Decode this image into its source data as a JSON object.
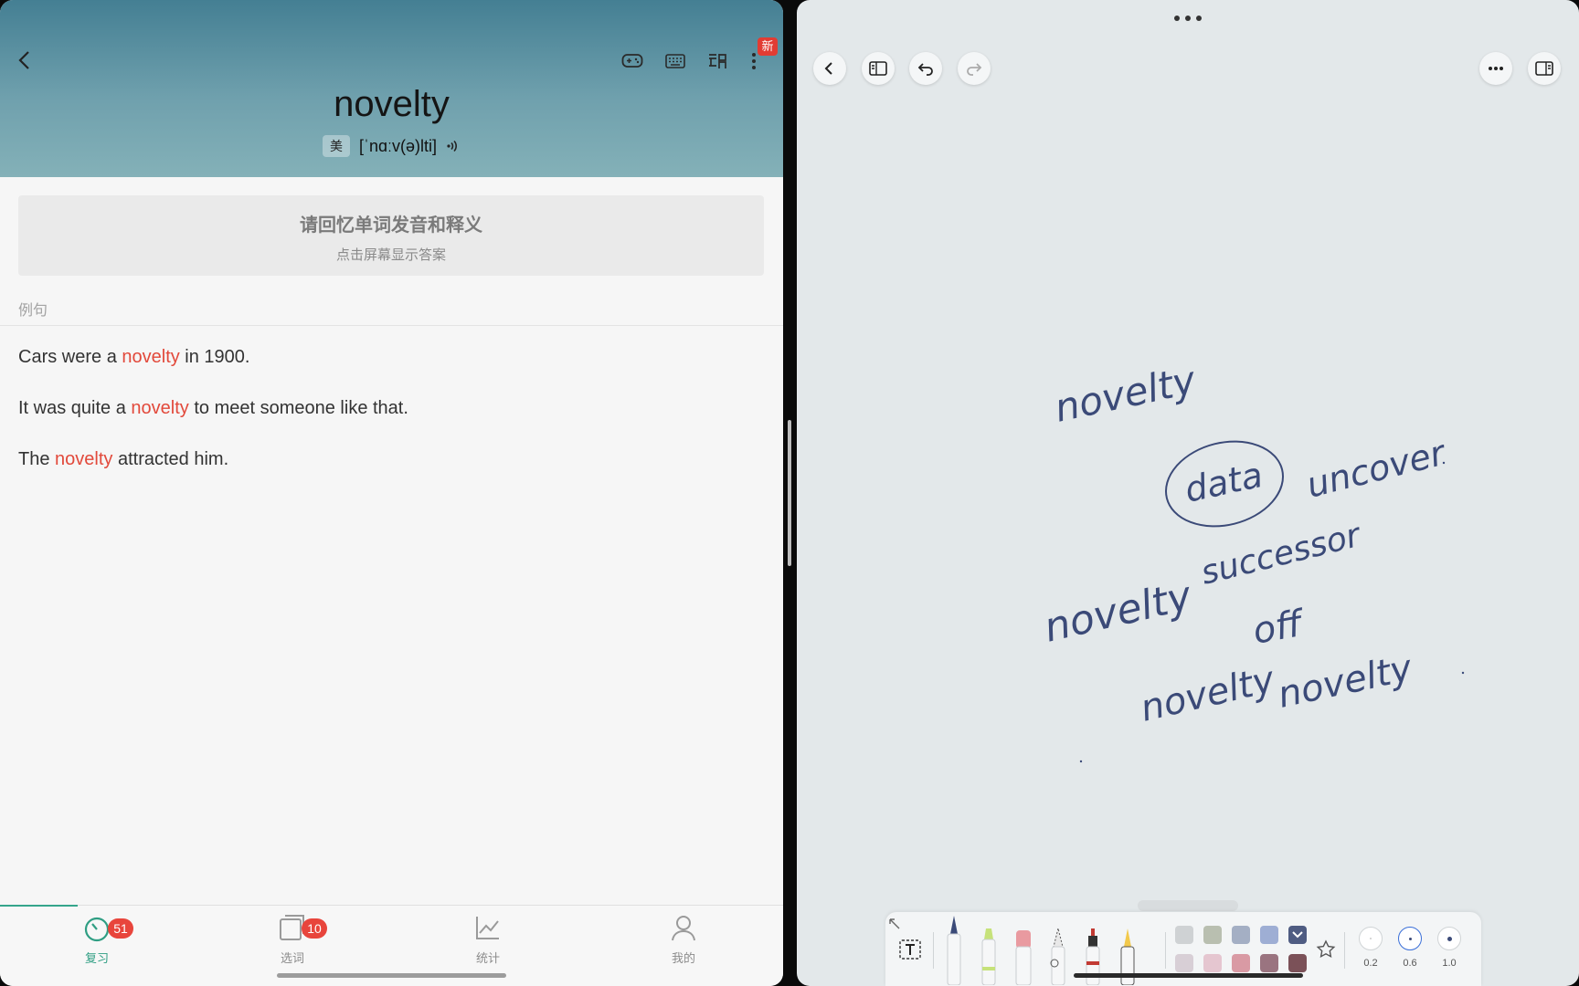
{
  "vocab_app": {
    "header": {
      "word": "novelty",
      "region_badge": "美",
      "phonetic": "[ˈnɑːv(ə)lti]",
      "new_badge": "新"
    },
    "hint": {
      "title": "请回忆单词发音和释义",
      "subtitle": "点击屏幕显示答案"
    },
    "examples_label": "例句",
    "examples": [
      {
        "before": "Cars were a ",
        "highlight": "novelty",
        "after": " in 1900."
      },
      {
        "before": "It was quite a ",
        "highlight": "novelty",
        "after": " to meet someone like that."
      },
      {
        "before": "The ",
        "highlight": "novelty",
        "after": " attracted him."
      }
    ],
    "tabs": [
      {
        "label": "复习",
        "badge": "51",
        "icon": "review-clock-icon",
        "active": true
      },
      {
        "label": "选词",
        "badge": "10",
        "icon": "word-select-icon",
        "active": false
      },
      {
        "label": "统计",
        "badge": "",
        "icon": "stats-chart-icon",
        "active": false
      },
      {
        "label": "我的",
        "badge": "",
        "icon": "profile-icon",
        "active": false
      }
    ],
    "colors": {
      "accent": "#2f9e83",
      "highlight": "#e2493b",
      "badge": "#e8453c"
    }
  },
  "notes_app": {
    "handwriting": [
      "novelty",
      "data",
      "uncover",
      "novelty",
      "successor",
      "off",
      "novelty",
      "novelty"
    ],
    "pen_sizes": [
      "0.2",
      "0.6",
      "1.0"
    ],
    "selected_pen_size": "0.6",
    "ink_color": "#3b4a78",
    "palette": {
      "row1": [
        "#cfd2d4",
        "#b9bfb0",
        "#a4afc4",
        "#9eaed4",
        "#4f5c82"
      ],
      "row2": [
        "#d8cfd6",
        "#e5c6d0",
        "#d99aa4",
        "#9a7480",
        "#7b5158"
      ]
    }
  }
}
